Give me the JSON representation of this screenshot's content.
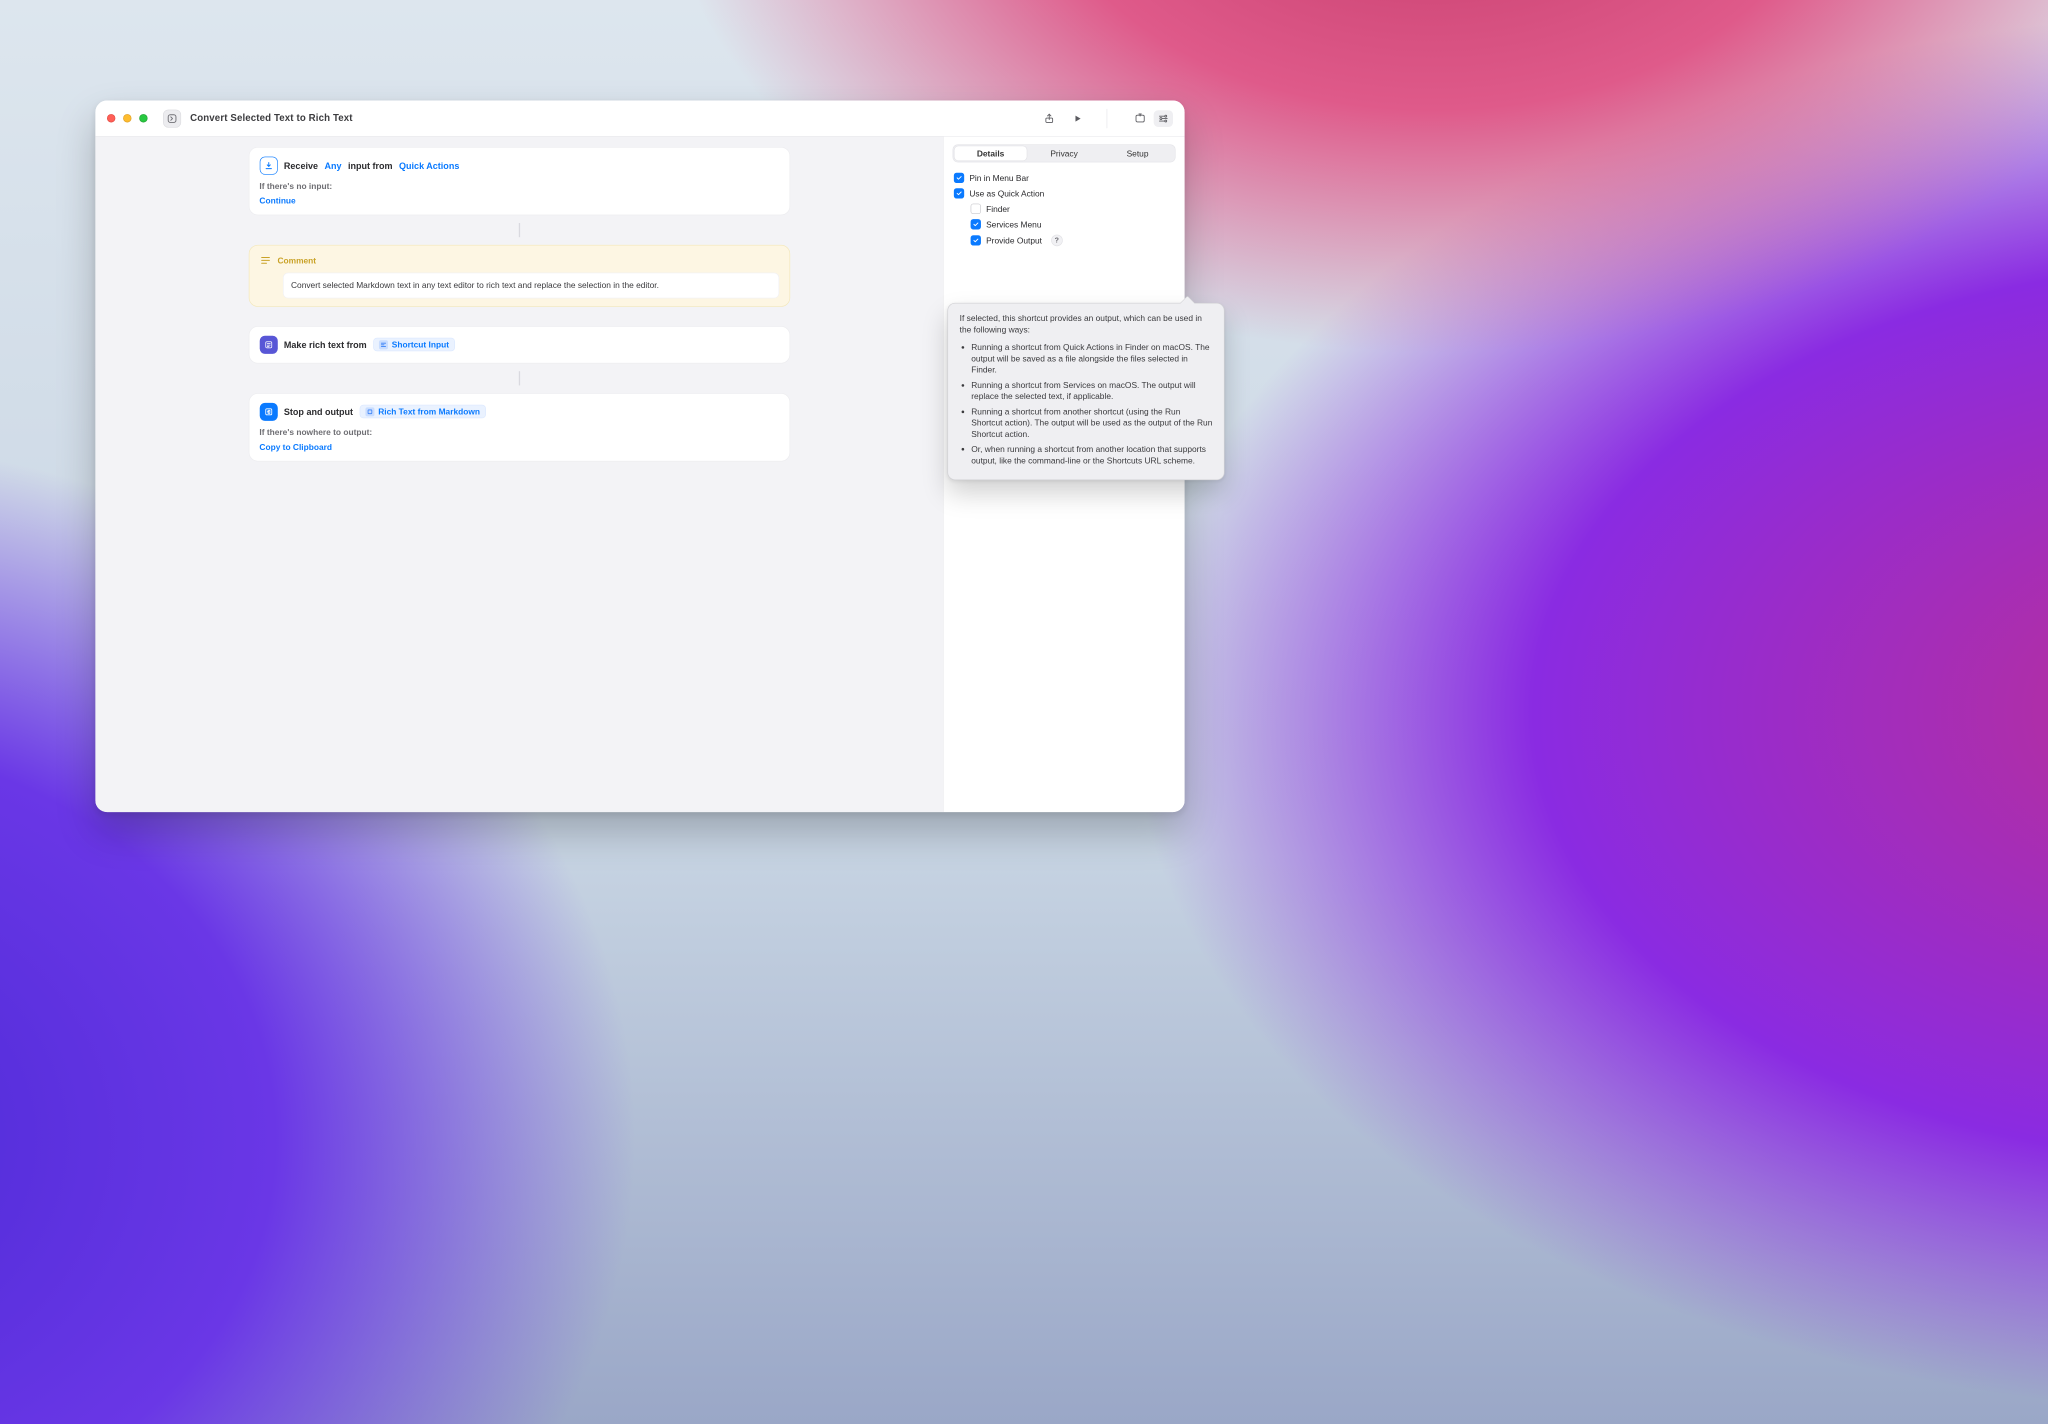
{
  "window": {
    "title": "Convert Selected Text to Rich Text"
  },
  "canvas": {
    "receive": {
      "label_pre": "Receive",
      "token_any": "Any",
      "label_mid": "input from",
      "token_source": "Quick Actions",
      "no_input_label": "If there's no input:",
      "no_input_action": "Continue"
    },
    "comment": {
      "title": "Comment",
      "body": "Convert selected Markdown text in any text editor to rich text and replace the selection in the editor."
    },
    "makerich": {
      "label": "Make rich text from",
      "input_chip": "Shortcut Input"
    },
    "stop": {
      "label": "Stop and output",
      "output_chip": "Rich Text from Markdown",
      "nowhere_label": "If there's nowhere to output:",
      "nowhere_action": "Copy to Clipboard"
    }
  },
  "sidebar": {
    "icons": {
      "library": "library",
      "settings": "settings"
    },
    "tabs": {
      "details": "Details",
      "privacy": "Privacy",
      "setup": "Setup",
      "active": "details"
    },
    "checks": {
      "pin_menu_bar": {
        "label": "Pin in Menu Bar",
        "checked": true
      },
      "quick_action": {
        "label": "Use as Quick Action",
        "checked": true
      },
      "finder": {
        "label": "Finder",
        "checked": false
      },
      "services": {
        "label": "Services Menu",
        "checked": true
      },
      "provide_output": {
        "label": "Provide Output",
        "checked": true
      }
    },
    "tooltip": {
      "intro": "If selected, this shortcut provides an output, which can be used in the following ways:",
      "bullets": [
        "Running a shortcut from Quick Actions in Finder on macOS. The output will be saved as a file alongside the files selected in Finder.",
        "Running a shortcut from Services on macOS. The output will replace the selected text, if applicable.",
        "Running a shortcut from another shortcut (using the Run Shortcut action). The output will be used as the output of the Run Shortcut action.",
        "Or, when running a shortcut from another location that supports output, like the command-line or the Shortcuts URL scheme."
      ]
    }
  }
}
